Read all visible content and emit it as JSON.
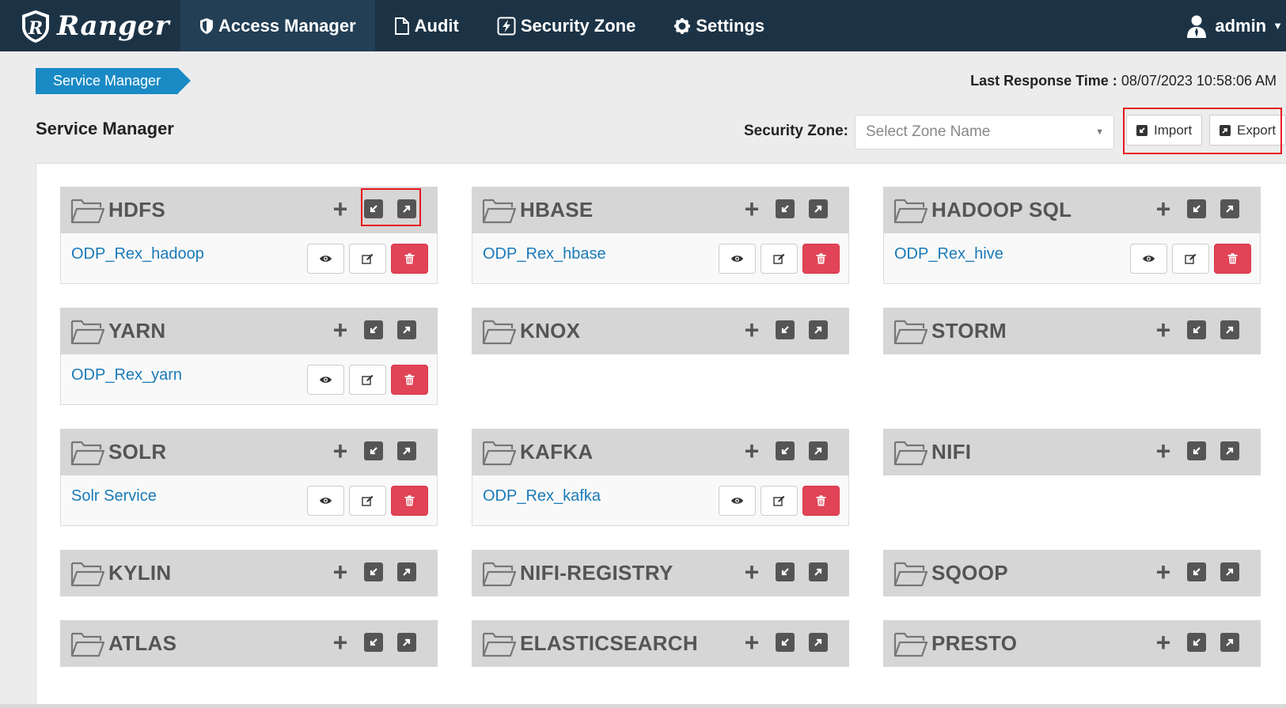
{
  "nav": {
    "brand": "Ranger",
    "items": [
      {
        "label": "Access Manager",
        "icon": "shield-icon",
        "active": true
      },
      {
        "label": "Audit",
        "icon": "file-icon"
      },
      {
        "label": "Security Zone",
        "icon": "lightning-icon"
      },
      {
        "label": "Settings",
        "icon": "gear-icon"
      }
    ],
    "user": "admin"
  },
  "breadcrumb": "Service Manager",
  "last_response": {
    "label": "Last Response Time :",
    "value": "08/07/2023 10:58:06 AM"
  },
  "page_title": "Service Manager",
  "zone": {
    "label": "Security Zone:",
    "placeholder": "Select Zone Name"
  },
  "import_label": "Import",
  "export_label": "Export",
  "cards": [
    {
      "title": "HDFS",
      "service": "ODP_Rex_hadoop"
    },
    {
      "title": "HBASE",
      "service": "ODP_Rex_hbase"
    },
    {
      "title": "HADOOP SQL",
      "service": "ODP_Rex_hive"
    },
    {
      "title": "YARN",
      "service": "ODP_Rex_yarn"
    },
    {
      "title": "KNOX",
      "service": ""
    },
    {
      "title": "STORM",
      "service": ""
    },
    {
      "title": "SOLR",
      "service": "Solr Service"
    },
    {
      "title": "KAFKA",
      "service": "ODP_Rex_kafka"
    },
    {
      "title": "NIFI",
      "service": ""
    },
    {
      "title": "KYLIN",
      "service": ""
    },
    {
      "title": "NIFI-REGISTRY",
      "service": ""
    },
    {
      "title": "SQOOP",
      "service": ""
    },
    {
      "title": "ATLAS",
      "service": ""
    },
    {
      "title": "ELASTICSEARCH",
      "service": ""
    },
    {
      "title": "PRESTO",
      "service": ""
    }
  ],
  "colors": {
    "navbar": "#1c3346",
    "accent": "#1a8ac5",
    "delete": "#e04456",
    "highlight": "#e8161f"
  }
}
